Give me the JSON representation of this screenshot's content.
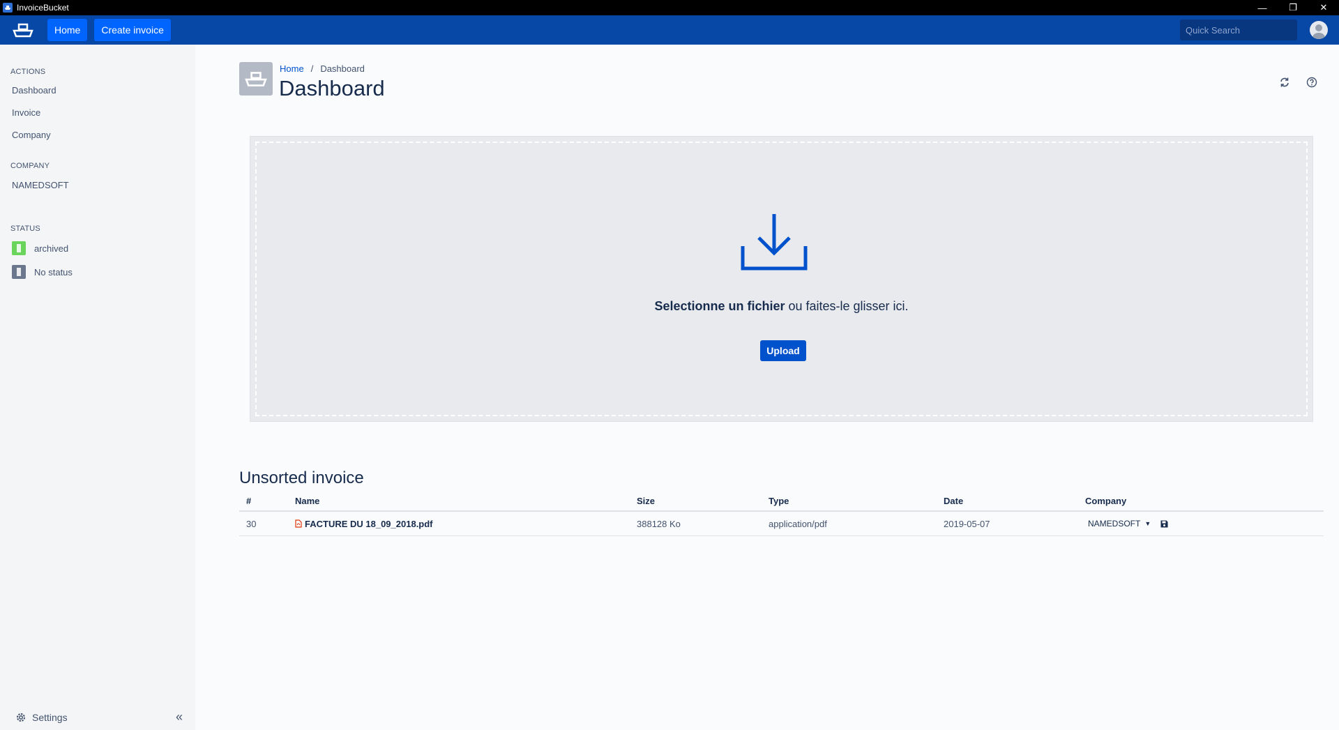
{
  "window": {
    "title": "InvoiceBucket"
  },
  "topnav": {
    "home_label": "Home",
    "create_label": "Create invoice",
    "search_placeholder": "Quick Search"
  },
  "sidebar": {
    "actions_header": "ACTIONS",
    "actions": [
      "Dashboard",
      "Invoice",
      "Company"
    ],
    "company_header": "COMPANY",
    "companies": [
      "NAMEDSOFT"
    ],
    "status_header": "STATUS",
    "statuses": [
      {
        "label": "archived",
        "color": "#36b37e"
      },
      {
        "label": "No status",
        "color": "#6b778c"
      }
    ],
    "settings_label": "Settings"
  },
  "page": {
    "breadcrumb_home": "Home",
    "breadcrumb_sep": "/",
    "breadcrumb_current": "Dashboard",
    "title": "Dashboard"
  },
  "dropzone": {
    "text_bold": "Selectionne un fichier",
    "text_rest": " ou faites-le glisser ici.",
    "upload_label": "Upload"
  },
  "unsorted": {
    "title": "Unsorted invoice",
    "columns": [
      "#",
      "Name",
      "Size",
      "Type",
      "Date",
      "Company"
    ],
    "rows": [
      {
        "id": "30",
        "name": "FACTURE DU 18_09_2018.pdf",
        "size": "388128 Ko",
        "type": "application/pdf",
        "date": "2019-05-07",
        "company": "NAMEDSOFT"
      }
    ]
  },
  "colors": {
    "brand": "#0747a6",
    "accent": "#0052cc"
  }
}
